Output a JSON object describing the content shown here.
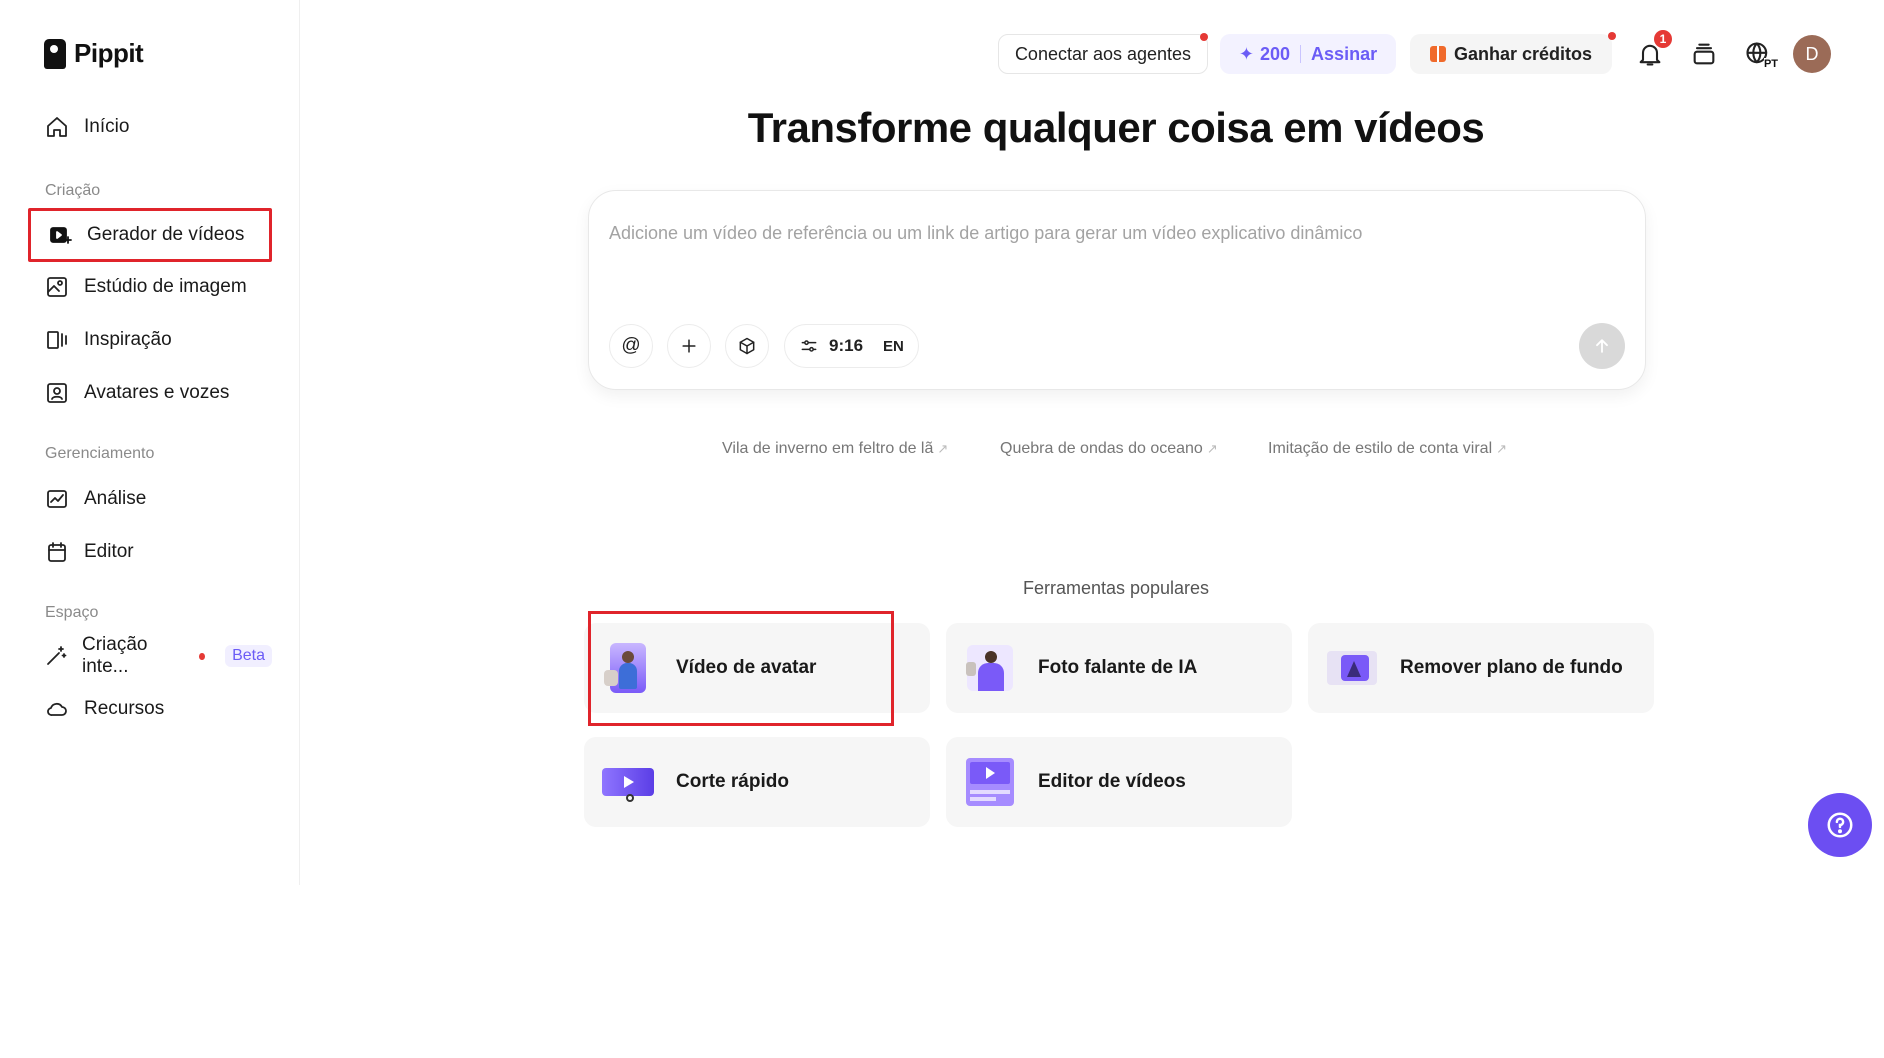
{
  "app": {
    "name": "Pippit"
  },
  "sidebar": {
    "home": {
      "label": "Início",
      "icon": "home-icon"
    },
    "sections": [
      {
        "title": "Criação"
      },
      {
        "title": "Gerenciamento"
      },
      {
        "title": "Espaço"
      }
    ],
    "items": [
      {
        "label": "Gerador de vídeos",
        "icon": "video-generator-icon",
        "selected": true
      },
      {
        "label": "Estúdio de imagem",
        "icon": "image-studio-icon"
      },
      {
        "label": "Inspiração",
        "icon": "inspiration-icon"
      },
      {
        "label": "Avatares e vozes",
        "icon": "avatar-voice-icon"
      },
      {
        "label": "Análise",
        "icon": "chart-icon"
      },
      {
        "label": "Editor",
        "icon": "calendar-icon"
      },
      {
        "label": "Criação inte...",
        "icon": "magic-wand-icon",
        "badge": "Beta"
      },
      {
        "label": "Recursos",
        "icon": "cloud-icon"
      }
    ]
  },
  "topbar": {
    "connect_label": "Conectar aos agentes",
    "credits_value": "200",
    "subscribe_label": "Assinar",
    "earn_label": "Ganhar créditos",
    "notification_count": "1",
    "language": "PT",
    "avatar_initial": "D"
  },
  "main": {
    "title": "Transforme qualquer coisa em vídeos",
    "prompt_placeholder": "Adicione um vídeo de referência ou um link de artigo para gerar um vídeo explicativo dinâmico",
    "ratio": "9:16",
    "lang": "EN",
    "suggestions": [
      "Vila de inverno em feltro de lã",
      "Quebra de ondas do oceano",
      "Imitação de estilo de conta viral"
    ],
    "popular_title": "Ferramentas populares",
    "tools": [
      {
        "label": "Vídeo de avatar",
        "highlighted": true
      },
      {
        "label": "Foto falante de IA"
      },
      {
        "label": "Remover plano de fundo"
      },
      {
        "label": "Corte rápido"
      },
      {
        "label": "Editor de vídeos"
      }
    ]
  },
  "colors": {
    "accent": "#6b5cf6",
    "highlight_outline": "#e0242b",
    "help_button": "#6c4ef2"
  }
}
